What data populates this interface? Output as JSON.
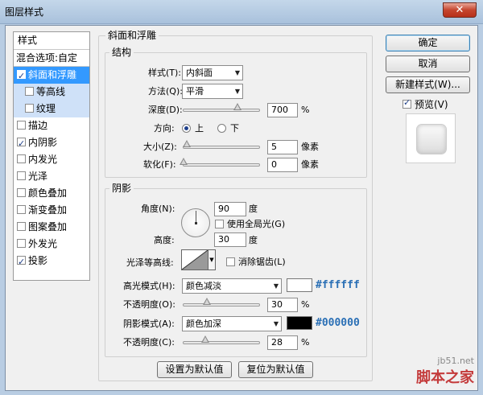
{
  "window": {
    "title": "图层样式",
    "close_glyph": "✕"
  },
  "style_list": {
    "header": "样式",
    "blend_options": "混合选项:自定",
    "items": [
      {
        "label": "斜面和浮雕",
        "checked": true,
        "selected": true,
        "sub": false
      },
      {
        "label": "等高线",
        "checked": false,
        "selected": false,
        "sub": true
      },
      {
        "label": "纹理",
        "checked": false,
        "selected": false,
        "sub": true
      },
      {
        "label": "描边",
        "checked": false,
        "selected": false,
        "sub": false
      },
      {
        "label": "内阴影",
        "checked": true,
        "selected": false,
        "sub": false
      },
      {
        "label": "内发光",
        "checked": false,
        "selected": false,
        "sub": false
      },
      {
        "label": "光泽",
        "checked": false,
        "selected": false,
        "sub": false
      },
      {
        "label": "颜色叠加",
        "checked": false,
        "selected": false,
        "sub": false
      },
      {
        "label": "渐变叠加",
        "checked": false,
        "selected": false,
        "sub": false
      },
      {
        "label": "图案叠加",
        "checked": false,
        "selected": false,
        "sub": false
      },
      {
        "label": "外发光",
        "checked": false,
        "selected": false,
        "sub": false
      },
      {
        "label": "投影",
        "checked": true,
        "selected": false,
        "sub": false
      }
    ]
  },
  "bevel": {
    "title": "斜面和浮雕",
    "structure_title": "结构",
    "style_label": "样式(T):",
    "style_value": "内斜面",
    "technique_label": "方法(Q):",
    "technique_value": "平滑",
    "depth_label": "深度(D):",
    "depth_value": "700",
    "depth_unit": "%",
    "depth_fraction": 0.7,
    "direction_label": "方向:",
    "direction_up": "上",
    "direction_down": "下",
    "size_label": "大小(Z):",
    "size_value": "5",
    "size_unit": "像素",
    "size_fraction": 0.04,
    "soften_label": "软化(F):",
    "soften_value": "0",
    "soften_unit": "像素",
    "soften_fraction": 0.0
  },
  "shading": {
    "title": "阴影",
    "angle_label": "角度(N):",
    "angle_value": "90",
    "angle_unit": "度",
    "global_light_label": "使用全局光(G)",
    "altitude_label": "高度:",
    "altitude_value": "30",
    "altitude_unit": "度",
    "gloss_label": "光泽等高线:",
    "antialias_label": "消除锯齿(L)",
    "highlight_label": "高光模式(H):",
    "highlight_value": "颜色减淡",
    "highlight_color": "#ffffff",
    "highlight_hex": "#ffffff",
    "hl_opacity_label": "不透明度(O):",
    "hl_opacity_value": "30",
    "hl_opacity_unit": "%",
    "hl_opacity_fraction": 0.3,
    "shadow_label": "阴影模式(A):",
    "shadow_value": "颜色加深",
    "shadow_color": "#000000",
    "shadow_hex": "#000000",
    "sh_opacity_label": "不透明度(C):",
    "sh_opacity_value": "28",
    "sh_opacity_unit": "%",
    "sh_opacity_fraction": 0.28
  },
  "buttons": {
    "ok": "确定",
    "cancel": "取消",
    "new_style": "新建样式(W)...",
    "preview": "预览(V)",
    "make_default": "设置为默认值",
    "reset_default": "复位为默认值"
  },
  "watermark": {
    "site": "jb51.net",
    "name": "脚本之家"
  }
}
